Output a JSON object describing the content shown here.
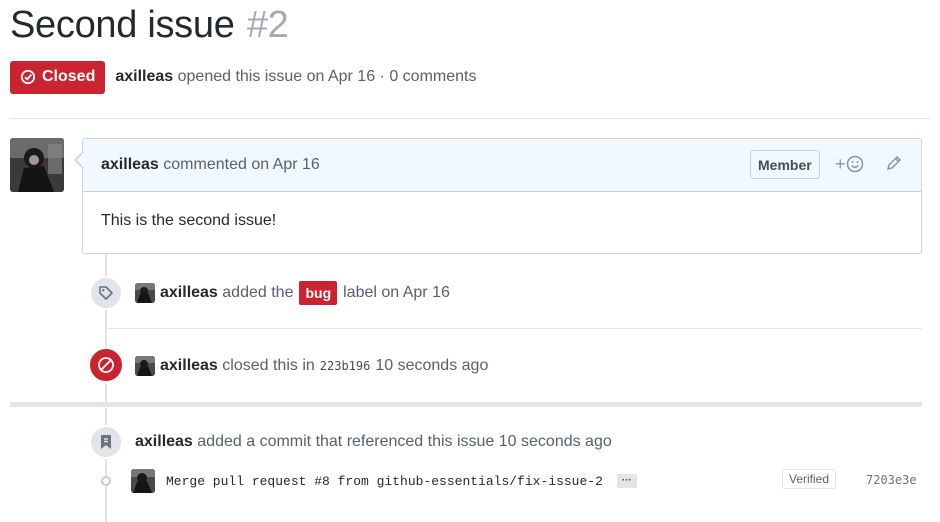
{
  "issue": {
    "title": "Second issue",
    "number": "#2",
    "state_label": "Closed",
    "author": "axilleas",
    "meta_text": "opened this issue on Apr 16 · 0 comments"
  },
  "comment": {
    "author": "axilleas",
    "action": "commented on Apr 16",
    "role_badge": "Member",
    "react_plus": "+",
    "body": "This is the second issue!"
  },
  "events": [
    {
      "actor": "axilleas",
      "pre": "added the",
      "label": "bug",
      "post": "label on Apr 16",
      "icon": "tag-icon"
    },
    {
      "actor": "axilleas",
      "pre": "closed this in",
      "sha": "223b196",
      "post": "10 seconds ago",
      "icon": "circle-slash-icon"
    },
    {
      "actor": "axilleas",
      "text": "added a commit that referenced this issue 10 seconds ago",
      "icon": "bookmark-icon"
    }
  ],
  "commit": {
    "message": "Merge pull request #8 from github-essentials/fix-issue-2",
    "ellipsis": "···",
    "verified": "Verified",
    "sha": "7203e3e"
  },
  "colors": {
    "closed_red": "#cb2431",
    "header_blue": "#f1f8ff",
    "border": "#e1e4e8"
  }
}
